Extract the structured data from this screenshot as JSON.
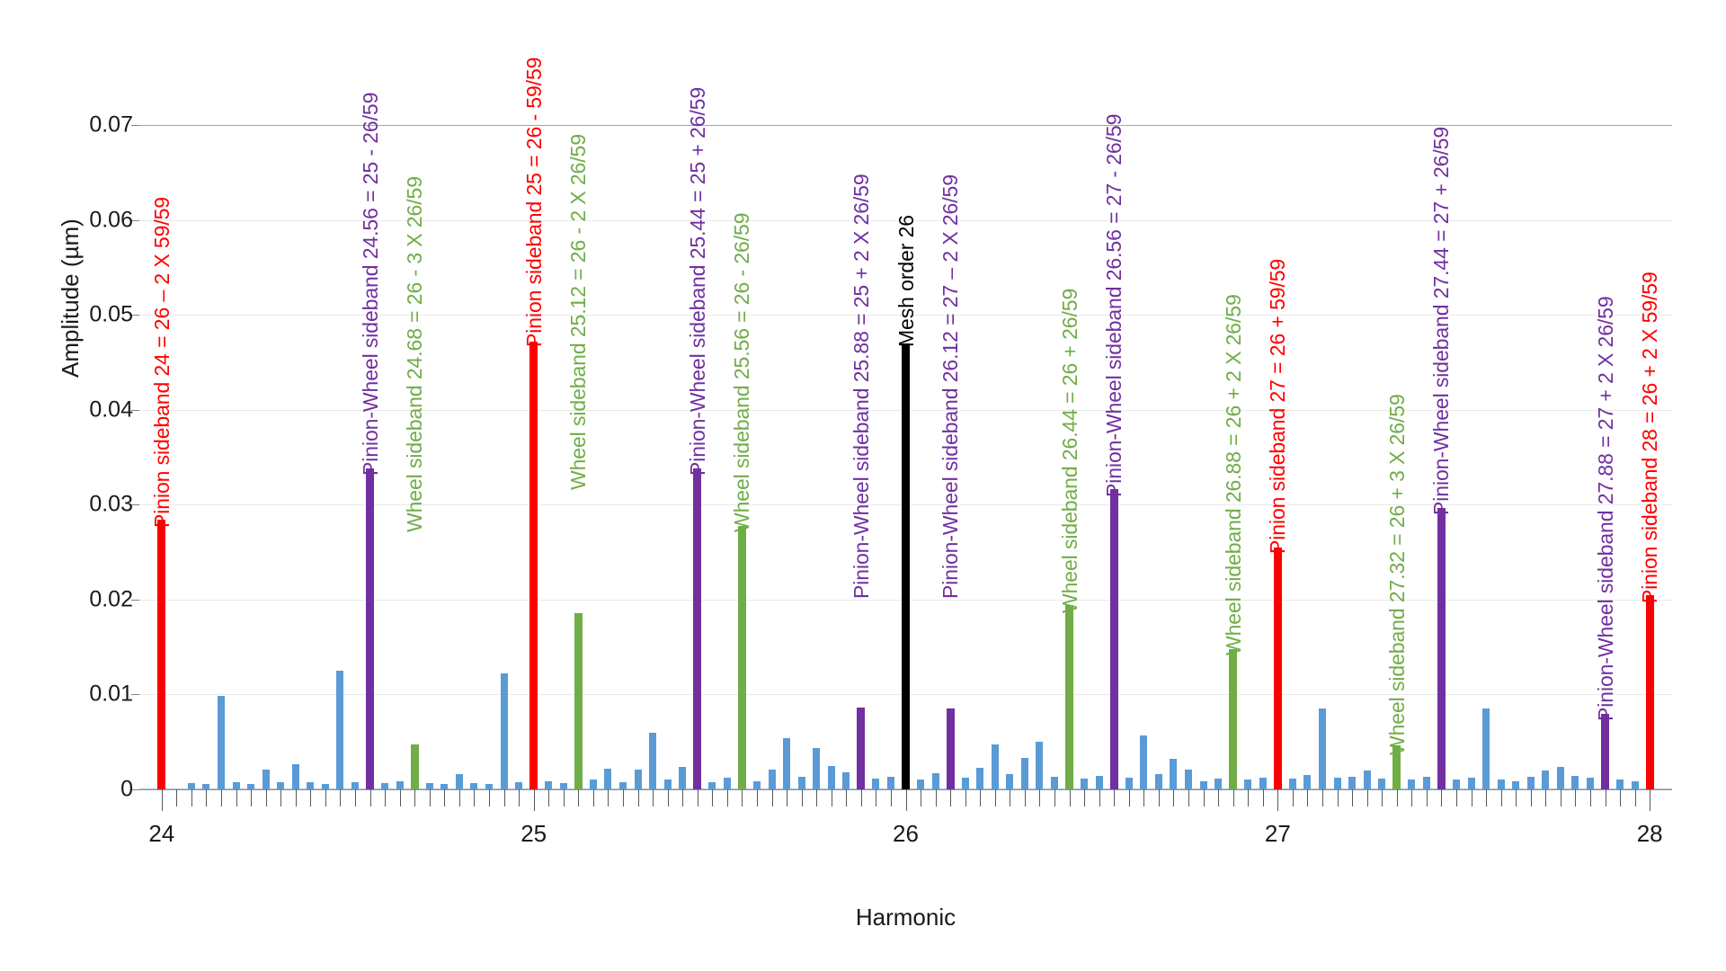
{
  "chart_data": {
    "type": "bar",
    "title": "",
    "xlabel": "Harmonic",
    "ylabel": "Amplitude (µm)",
    "xlim": [
      23.94,
      28.06
    ],
    "ylim": [
      0,
      0.0775
    ],
    "grid": true,
    "legend": "none",
    "x_ticks": [
      {
        "value": 24,
        "label": "24"
      },
      {
        "value": 25,
        "label": "25"
      },
      {
        "value": 26,
        "label": "26"
      },
      {
        "value": 27,
        "label": "27"
      },
      {
        "value": 28,
        "label": "28"
      }
    ],
    "x_minor_tick_step": 0.04,
    "y_ticks": [
      {
        "value": 0,
        "label": "0"
      },
      {
        "value": 0.01,
        "label": "0.01"
      },
      {
        "value": 0.02,
        "label": "0.02"
      },
      {
        "value": 0.03,
        "label": "0.03"
      },
      {
        "value": 0.04,
        "label": "0.04"
      },
      {
        "value": 0.05,
        "label": "0.05"
      },
      {
        "value": 0.06,
        "label": "0.06"
      },
      {
        "value": 0.07,
        "label": "0.07"
      }
    ],
    "y_major_gridline": 0.07,
    "series_colors": {
      "default": "#5b9bd5",
      "pinion_sideband": "#ff0000",
      "pinion_wheel_sideband": "#7030a0",
      "wheel_sideband": "#70ad47",
      "mesh_order": "#000000"
    },
    "bars": [
      {
        "x": 24.0,
        "y": 0.0284,
        "color": "red"
      },
      {
        "x": 24.08,
        "y": 0.0007,
        "color": "blue"
      },
      {
        "x": 24.12,
        "y": 0.0006,
        "color": "blue"
      },
      {
        "x": 24.16,
        "y": 0.0099,
        "color": "blue"
      },
      {
        "x": 24.2,
        "y": 0.0008,
        "color": "blue"
      },
      {
        "x": 24.24,
        "y": 0.0006,
        "color": "blue"
      },
      {
        "x": 24.28,
        "y": 0.0021,
        "color": "blue"
      },
      {
        "x": 24.32,
        "y": 0.0008,
        "color": "blue"
      },
      {
        "x": 24.36,
        "y": 0.0027,
        "color": "blue"
      },
      {
        "x": 24.4,
        "y": 0.0008,
        "color": "blue"
      },
      {
        "x": 24.44,
        "y": 0.0006,
        "color": "blue"
      },
      {
        "x": 24.48,
        "y": 0.0125,
        "color": "blue"
      },
      {
        "x": 24.52,
        "y": 0.0008,
        "color": "blue"
      },
      {
        "x": 24.56,
        "y": 0.0338,
        "color": "purple"
      },
      {
        "x": 24.6,
        "y": 0.0007,
        "color": "blue"
      },
      {
        "x": 24.64,
        "y": 0.0009,
        "color": "blue"
      },
      {
        "x": 24.68,
        "y": 0.0047,
        "color": "green"
      },
      {
        "x": 24.72,
        "y": 0.0007,
        "color": "blue"
      },
      {
        "x": 24.76,
        "y": 0.0006,
        "color": "blue"
      },
      {
        "x": 24.8,
        "y": 0.0016,
        "color": "blue"
      },
      {
        "x": 24.84,
        "y": 0.0007,
        "color": "blue"
      },
      {
        "x": 24.88,
        "y": 0.0006,
        "color": "blue"
      },
      {
        "x": 24.92,
        "y": 0.0122,
        "color": "blue"
      },
      {
        "x": 24.96,
        "y": 0.0008,
        "color": "blue"
      },
      {
        "x": 25.0,
        "y": 0.0472,
        "color": "red"
      },
      {
        "x": 25.04,
        "y": 0.0009,
        "color": "blue"
      },
      {
        "x": 25.08,
        "y": 0.0007,
        "color": "blue"
      },
      {
        "x": 25.12,
        "y": 0.0186,
        "color": "green"
      },
      {
        "x": 25.16,
        "y": 0.001,
        "color": "blue"
      },
      {
        "x": 25.2,
        "y": 0.0022,
        "color": "blue"
      },
      {
        "x": 25.24,
        "y": 0.0008,
        "color": "blue"
      },
      {
        "x": 25.28,
        "y": 0.0021,
        "color": "blue"
      },
      {
        "x": 25.32,
        "y": 0.006,
        "color": "blue"
      },
      {
        "x": 25.36,
        "y": 0.001,
        "color": "blue"
      },
      {
        "x": 25.4,
        "y": 0.0024,
        "color": "blue"
      },
      {
        "x": 25.44,
        "y": 0.0338,
        "color": "purple"
      },
      {
        "x": 25.48,
        "y": 0.0008,
        "color": "blue"
      },
      {
        "x": 25.52,
        "y": 0.0012,
        "color": "blue"
      },
      {
        "x": 25.56,
        "y": 0.0278,
        "color": "green"
      },
      {
        "x": 25.6,
        "y": 0.0009,
        "color": "blue"
      },
      {
        "x": 25.64,
        "y": 0.0021,
        "color": "blue"
      },
      {
        "x": 25.68,
        "y": 0.0054,
        "color": "blue"
      },
      {
        "x": 25.72,
        "y": 0.0013,
        "color": "blue"
      },
      {
        "x": 25.76,
        "y": 0.0044,
        "color": "blue"
      },
      {
        "x": 25.8,
        "y": 0.0025,
        "color": "blue"
      },
      {
        "x": 25.84,
        "y": 0.0018,
        "color": "blue"
      },
      {
        "x": 25.88,
        "y": 0.0086,
        "color": "purple"
      },
      {
        "x": 25.92,
        "y": 0.0011,
        "color": "blue"
      },
      {
        "x": 25.96,
        "y": 0.0013,
        "color": "blue"
      },
      {
        "x": 26.0,
        "y": 0.047,
        "color": "black"
      },
      {
        "x": 26.04,
        "y": 0.001,
        "color": "blue"
      },
      {
        "x": 26.08,
        "y": 0.0017,
        "color": "blue"
      },
      {
        "x": 26.12,
        "y": 0.0085,
        "color": "purple"
      },
      {
        "x": 26.16,
        "y": 0.0012,
        "color": "blue"
      },
      {
        "x": 26.2,
        "y": 0.0023,
        "color": "blue"
      },
      {
        "x": 26.24,
        "y": 0.0047,
        "color": "blue"
      },
      {
        "x": 26.28,
        "y": 0.0016,
        "color": "blue"
      },
      {
        "x": 26.32,
        "y": 0.0033,
        "color": "blue"
      },
      {
        "x": 26.36,
        "y": 0.005,
        "color": "blue"
      },
      {
        "x": 26.4,
        "y": 0.0013,
        "color": "blue"
      },
      {
        "x": 26.44,
        "y": 0.0194,
        "color": "green"
      },
      {
        "x": 26.48,
        "y": 0.0011,
        "color": "blue"
      },
      {
        "x": 26.52,
        "y": 0.0014,
        "color": "blue"
      },
      {
        "x": 26.56,
        "y": 0.0316,
        "color": "purple"
      },
      {
        "x": 26.6,
        "y": 0.0012,
        "color": "blue"
      },
      {
        "x": 26.64,
        "y": 0.0057,
        "color": "blue"
      },
      {
        "x": 26.68,
        "y": 0.0016,
        "color": "blue"
      },
      {
        "x": 26.72,
        "y": 0.0032,
        "color": "blue"
      },
      {
        "x": 26.76,
        "y": 0.0021,
        "color": "blue"
      },
      {
        "x": 26.8,
        "y": 0.0009,
        "color": "blue"
      },
      {
        "x": 26.84,
        "y": 0.0011,
        "color": "blue"
      },
      {
        "x": 26.88,
        "y": 0.0148,
        "color": "green"
      },
      {
        "x": 26.92,
        "y": 0.001,
        "color": "blue"
      },
      {
        "x": 26.96,
        "y": 0.0012,
        "color": "blue"
      },
      {
        "x": 27.0,
        "y": 0.0255,
        "color": "red"
      },
      {
        "x": 27.04,
        "y": 0.0011,
        "color": "blue"
      },
      {
        "x": 27.08,
        "y": 0.0015,
        "color": "blue"
      },
      {
        "x": 27.12,
        "y": 0.0085,
        "color": "blue"
      },
      {
        "x": 27.16,
        "y": 0.0012,
        "color": "blue"
      },
      {
        "x": 27.2,
        "y": 0.0013,
        "color": "blue"
      },
      {
        "x": 27.24,
        "y": 0.002,
        "color": "blue"
      },
      {
        "x": 27.28,
        "y": 0.0011,
        "color": "blue"
      },
      {
        "x": 27.32,
        "y": 0.0046,
        "color": "green"
      },
      {
        "x": 27.36,
        "y": 0.001,
        "color": "blue"
      },
      {
        "x": 27.4,
        "y": 0.0013,
        "color": "blue"
      },
      {
        "x": 27.44,
        "y": 0.0297,
        "color": "purple"
      },
      {
        "x": 27.48,
        "y": 0.001,
        "color": "blue"
      },
      {
        "x": 27.52,
        "y": 0.0012,
        "color": "blue"
      },
      {
        "x": 27.56,
        "y": 0.0085,
        "color": "blue"
      },
      {
        "x": 27.6,
        "y": 0.001,
        "color": "blue"
      },
      {
        "x": 27.64,
        "y": 0.0009,
        "color": "blue"
      },
      {
        "x": 27.68,
        "y": 0.0013,
        "color": "blue"
      },
      {
        "x": 27.72,
        "y": 0.002,
        "color": "blue"
      },
      {
        "x": 27.76,
        "y": 0.0024,
        "color": "blue"
      },
      {
        "x": 27.8,
        "y": 0.0014,
        "color": "blue"
      },
      {
        "x": 27.84,
        "y": 0.0012,
        "color": "blue"
      },
      {
        "x": 27.88,
        "y": 0.008,
        "color": "purple"
      },
      {
        "x": 27.92,
        "y": 0.001,
        "color": "blue"
      },
      {
        "x": 27.96,
        "y": 0.0009,
        "color": "blue"
      },
      {
        "x": 28.0,
        "y": 0.0205,
        "color": "red"
      }
    ],
    "annotations": [
      {
        "x": 24.0,
        "text": "Pinion sideband 24 = 26 – 2 X 59/59",
        "color": "red",
        "base_y": 0.029
      },
      {
        "x": 24.56,
        "text": "Pinion-Wheel sideband 24.56 = 25 - 26/59",
        "color": "purple",
        "base_y": 0.0345
      },
      {
        "x": 24.68,
        "text": "Wheel sideband 24.68 = 26 - 3 X 26/59",
        "color": "green",
        "base_y": 0.0285
      },
      {
        "x": 25.0,
        "text": "Pinion sideband 25 = 26 - 59/59",
        "color": "red",
        "base_y": 0.048
      },
      {
        "x": 25.12,
        "text": "Wheel sideband 25.12 = 26 - 2 X 26/59",
        "color": "green",
        "base_y": 0.033
      },
      {
        "x": 25.44,
        "text": "Pinion-Wheel sideband 25.44 = 25 + 26/59",
        "color": "purple",
        "base_y": 0.0345
      },
      {
        "x": 25.56,
        "text": "Wheel sideband 25.56 = 26 - 26/59",
        "color": "green",
        "base_y": 0.0285
      },
      {
        "x": 25.88,
        "text": "Pinion-Wheel sideband 25.88 = 25 + 2 X 26/59",
        "color": "purple",
        "base_y": 0.0215
      },
      {
        "x": 26.0,
        "text": "Mesh order 26",
        "color": "black",
        "base_y": 0.048
      },
      {
        "x": 26.12,
        "text": "Pinion-Wheel sideband 26.12 = 27 – 2 X 26/59",
        "color": "purple",
        "base_y": 0.0215
      },
      {
        "x": 26.44,
        "text": "Wheel sideband 26.44 = 26 + 26/59",
        "color": "green",
        "base_y": 0.02
      },
      {
        "x": 26.56,
        "text": "Pinion-Wheel sideband 26.56 = 27 - 26/59",
        "color": "purple",
        "base_y": 0.0322
      },
      {
        "x": 26.88,
        "text": "Wheel sideband 26.88 = 26 + 2 X 26/59",
        "color": "green",
        "base_y": 0.0155
      },
      {
        "x": 27.0,
        "text": "Pinion sideband 27 = 26 + 59/59",
        "color": "red",
        "base_y": 0.0262
      },
      {
        "x": 27.32,
        "text": "Wheel sideband 27.32 = 26 + 3 X 26/59",
        "color": "green",
        "base_y": 0.005
      },
      {
        "x": 27.44,
        "text": "Pinion-Wheel sideband 27.44 = 27 + 26/59",
        "color": "purple",
        "base_y": 0.0303
      },
      {
        "x": 27.88,
        "text": "Pinion-Wheel sideband 27.88 = 27 + 2 X 26/59",
        "color": "purple",
        "base_y": 0.0086
      },
      {
        "x": 28.0,
        "text": "Pinion sideband 28 = 26 + 2 X 59/59",
        "color": "red",
        "base_y": 0.021
      }
    ]
  }
}
